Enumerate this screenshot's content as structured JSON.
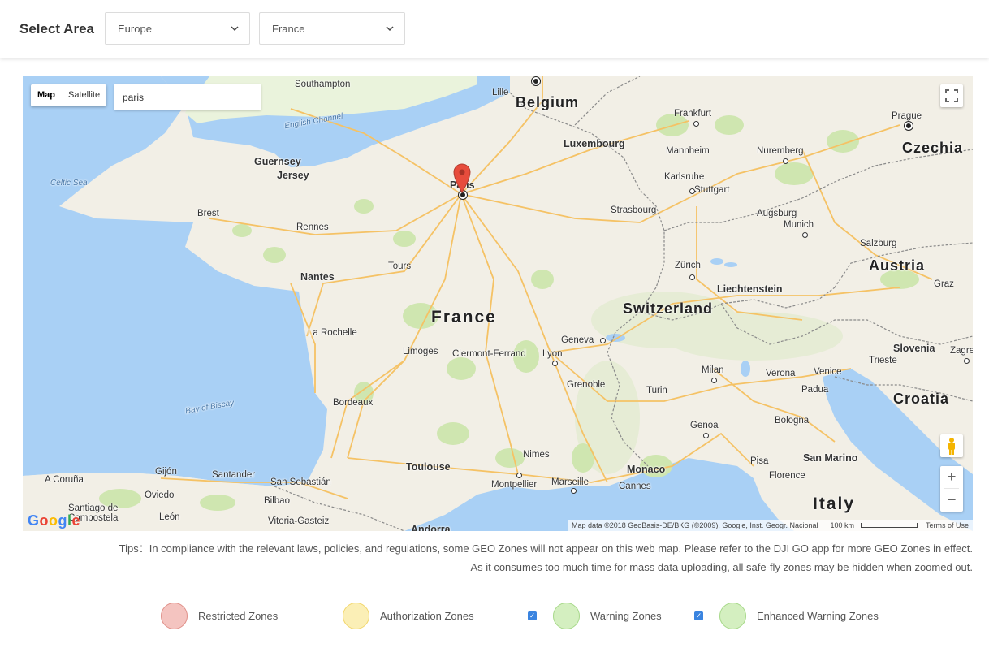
{
  "header": {
    "title": "Select Area",
    "region_select": {
      "value": "Europe"
    },
    "country_select": {
      "value": "France"
    }
  },
  "map": {
    "map_type": {
      "map_label": "Map",
      "satellite_label": "Satellite",
      "selected": "Map"
    },
    "search": {
      "value": "paris"
    },
    "logo": "Google",
    "attribution": "Map data ©2018 GeoBasis-DE/BKG (©2009), Google, Inst. Geogr. Nacional",
    "scale": "100 km",
    "terms": "Terms of Use",
    "marker": {
      "place": "Paris",
      "color": "#e74c3c"
    },
    "labels": {
      "france": "France",
      "belgium": "Belgium",
      "luxembourg": "Luxembourg",
      "switzerland": "Switzerland",
      "austria": "Austria",
      "czechia": "Czechia",
      "liechtenstein": "Liechtenstein",
      "slovenia": "Slovenia",
      "croatia": "Croatia",
      "italy": "Italy",
      "monaco": "Monaco",
      "san_marino": "San Marino",
      "andorra": "Andorra",
      "guernsey": "Guernsey",
      "jersey": "Jersey",
      "english_channel": "English Channel",
      "celtic_sea": "Celtic Sea",
      "bay_of_biscay": "Bay of Biscay",
      "southampton": "Southampton",
      "lille": "Lille",
      "frankfurt": "Frankfurt",
      "prague": "Prague",
      "mannheim": "Mannheim",
      "nuremberg": "Nuremberg",
      "karlsruhe": "Karlsruhe",
      "stuttgart": "Stuttgart",
      "strasbourg": "Strasbourg",
      "augsburg": "Augsburg",
      "munich": "Munich",
      "salzburg": "Salzburg",
      "zurich": "Zürich",
      "graz": "Graz",
      "paris": "Paris",
      "brest": "Brest",
      "rennes": "Rennes",
      "tours": "Tours",
      "nantes": "Nantes",
      "la_rochelle": "La Rochelle",
      "limoges": "Limoges",
      "clermont_ferrand": "Clermont-Ferrand",
      "lyon": "Lyon",
      "geneva": "Geneva",
      "grenoble": "Grenoble",
      "milan": "Milan",
      "verona": "Verona",
      "venice": "Venice",
      "trieste": "Trieste",
      "zagreb": "Zagre",
      "turin": "Turin",
      "padua": "Padua",
      "bordeaux": "Bordeaux",
      "genoa": "Genoa",
      "bologna": "Bologna",
      "toulouse": "Toulouse",
      "nimes": "Nimes",
      "montpellier": "Montpellier",
      "marseille": "Marseille",
      "cannes": "Cannes",
      "pisa": "Pisa",
      "florence": "Florence",
      "a_coruna": "A Coruña",
      "gijon": "Gijón",
      "oviedo": "Oviedo",
      "santander": "Santander",
      "san_sebastian": "San Sebastián",
      "bilbao": "Bilbao",
      "vitoria_gasteiz": "Vitoria-Gasteiz",
      "santiago": "Santiago de Compostela",
      "leon": "León"
    }
  },
  "tips": {
    "line1": "Tips：In compliance with the relevant laws, policies, and regulations, some GEO Zones will not appear on this web map. Please refer to the DJI GO app for more GEO Zones in effect.",
    "line2": "As it consumes too much time for mass data uploading, all safe-fly zones may be hidden when zoomed out."
  },
  "legend": {
    "restricted": {
      "label": "Restricted Zones",
      "color": "#f4c4c0"
    },
    "authorization": {
      "label": "Authorization Zones",
      "color": "#fbefb6"
    },
    "warning": {
      "label": "Warning Zones",
      "color": "#d4efc0",
      "checked": true
    },
    "enhanced_warning": {
      "label": "Enhanced Warning Zones",
      "color": "#d4efc0",
      "checked": true
    }
  }
}
